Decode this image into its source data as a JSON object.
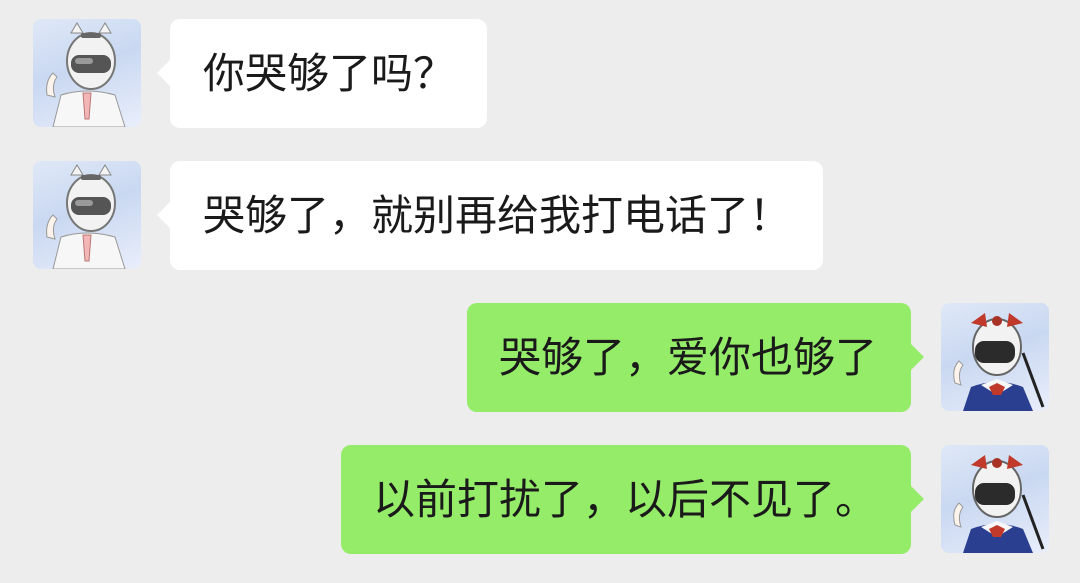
{
  "chat": {
    "messages": [
      {
        "side": "in",
        "text": "你哭够了吗？",
        "avatar": "helmet-cat-avatar"
      },
      {
        "side": "in",
        "text": "哭够了，就别再给我打电话了！",
        "avatar": "helmet-cat-avatar"
      },
      {
        "side": "out",
        "text": "哭够了，爱你也够了",
        "avatar": "helmet-bow-avatar"
      },
      {
        "side": "out",
        "text": "以前打扰了，以后不见了。",
        "avatar": "helmet-bow-avatar"
      }
    ]
  },
  "colors": {
    "background": "#ededed",
    "incoming_bubble": "#ffffff",
    "outgoing_bubble": "#95ec69",
    "text": "#1a1a1a"
  }
}
